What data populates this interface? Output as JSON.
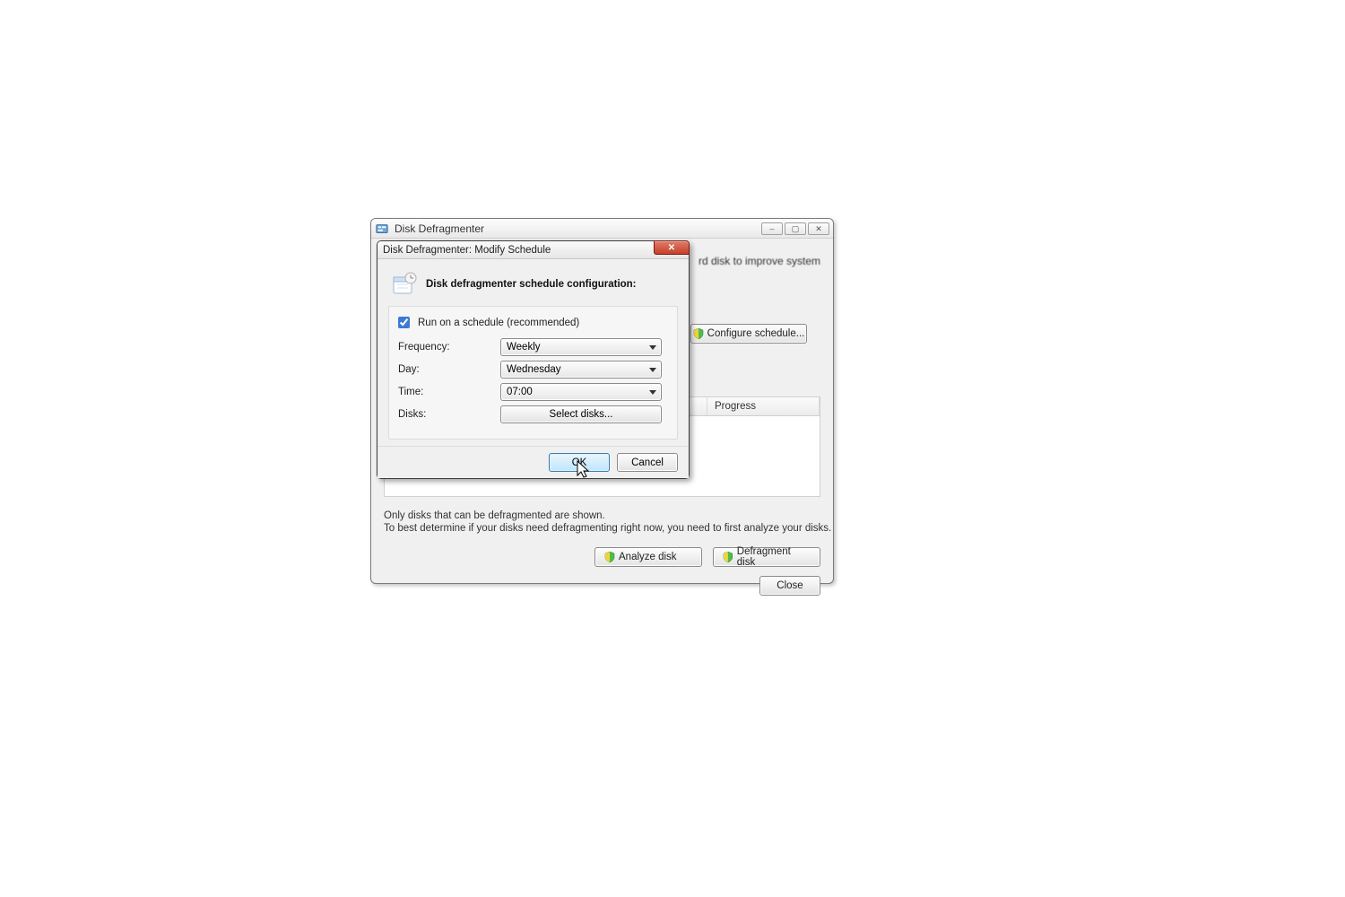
{
  "main": {
    "title": "Disk Defragmenter",
    "info_text": "rd disk to improve system",
    "configure_button": "Configure schedule...",
    "col_progress": "Progress",
    "note_line1": "Only disks that can be defragmented are shown.",
    "note_line2": "To best determine if your disks need defragmenting right now, you need to first analyze your disks.",
    "analyze_button": "Analyze disk",
    "defragment_button": "Defragment disk",
    "close_button": "Close"
  },
  "modal": {
    "title": "Disk Defragmenter: Modify Schedule",
    "header": "Disk defragmenter schedule configuration:",
    "run_schedule_label": "Run on a schedule (recommended)",
    "run_schedule_checked": true,
    "labels": {
      "frequency": "Frequency:",
      "day": "Day:",
      "time": "Time:",
      "disks": "Disks:"
    },
    "values": {
      "frequency": "Weekly",
      "day": "Wednesday",
      "time": "07:00"
    },
    "select_disks_button": "Select disks...",
    "ok_button": "OK",
    "cancel_button": "Cancel"
  }
}
